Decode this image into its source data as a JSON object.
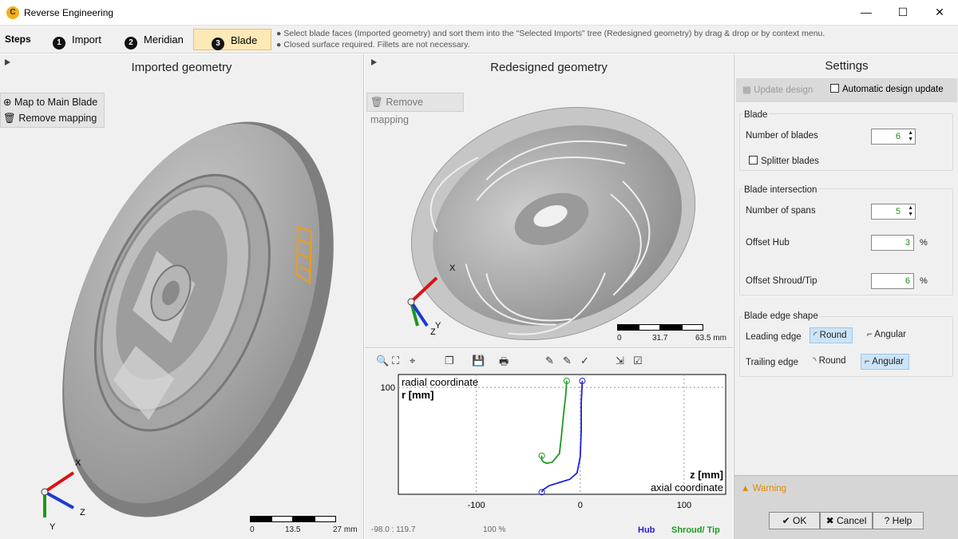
{
  "window": {
    "title": "Reverse Engineering",
    "app_icon": "C",
    "minimize": "—",
    "maximize": "☐",
    "close": "✕"
  },
  "steps": {
    "label": "Steps",
    "items": [
      {
        "num": "1",
        "label": "Import"
      },
      {
        "num": "2",
        "label": "Meridian"
      },
      {
        "num": "3",
        "label": "Blade"
      }
    ],
    "instructions": [
      "● Select blade faces (Imported geometry) and sort them into the \"Selected Imports\" tree (Redesigned geometry) by drag & drop or by context menu.",
      "● Closed surface required. Fillets are not necessary."
    ]
  },
  "imported": {
    "title": "Imported geometry",
    "map_button": "Map to Main Blade",
    "remove_button": "Remove mapping",
    "axes": {
      "x": "X",
      "y": "Y",
      "z": "Z"
    },
    "scale": {
      "labels": [
        "0",
        "13.5",
        "27 mm"
      ]
    }
  },
  "redesigned": {
    "title": "Redesigned geometry",
    "remove_button": "Remove mapping",
    "axes": {
      "x": "X",
      "y": "Y",
      "z": "Z"
    },
    "scale": {
      "labels": [
        "0",
        "31.7",
        "63.5 mm"
      ]
    }
  },
  "chart_toolbar": [
    "🔍",
    "⛶",
    "⌖",
    "❐",
    "💾",
    "🖶",
    "✎",
    "✎",
    "✓",
    "⇲",
    "☑"
  ],
  "chart_data": {
    "type": "line",
    "ylabel_top": "radial coordinate",
    "ylabel": "r [mm]",
    "xlabel": "z [mm]",
    "xlabel_bottom": "axial coordinate",
    "xlim": [
      -175,
      140
    ],
    "ylim": [
      0,
      112
    ],
    "x_ticks": [
      -100,
      0,
      100
    ],
    "y_ticks": [
      100
    ],
    "series": [
      {
        "name": "Hub",
        "color": "#2020dd",
        "x": [
          -37,
          -36,
          -30,
          -20,
          -10,
          -3,
          0,
          1,
          1,
          2
        ],
        "y": [
          2,
          4,
          8,
          11,
          14,
          20,
          35,
          60,
          85,
          106
        ]
      },
      {
        "name": "Shroud/ Tip",
        "color": "#1f9a1f",
        "x": [
          -37,
          -37,
          -35,
          -32,
          -27,
          -20,
          -18,
          -16,
          -14,
          -13
        ],
        "y": [
          36,
          32,
          30,
          29,
          30,
          38,
          55,
          75,
          92,
          106
        ]
      }
    ],
    "status_left": "-98.0 : 119.7",
    "status_zoom": "100 %"
  },
  "settings": {
    "title": "Settings",
    "update_design": "Update design",
    "auto_update": "Automatic design update",
    "blade": {
      "group": "Blade",
      "num_blades_label": "Number of blades",
      "num_blades": "6",
      "splitter": "Splitter blades"
    },
    "intersection": {
      "group": "Blade intersection",
      "spans_label": "Number of spans",
      "spans": "5",
      "hub_label": "Offset Hub",
      "hub": "3",
      "shroud_label": "Offset Shroud/Tip",
      "shroud": "6",
      "unit": "%"
    },
    "edge": {
      "group": "Blade edge shape",
      "leading_label": "Leading edge",
      "trailing_label": "Trailing edge",
      "round": "Round",
      "angular": "Angular"
    },
    "warning": "Warning",
    "ok": "OK",
    "cancel": "Cancel",
    "help": "Help"
  },
  "colors": {
    "accent": "#fde9b6",
    "warning": "#e08a00",
    "hub": "#2020dd",
    "shroud": "#1f9a1f"
  }
}
